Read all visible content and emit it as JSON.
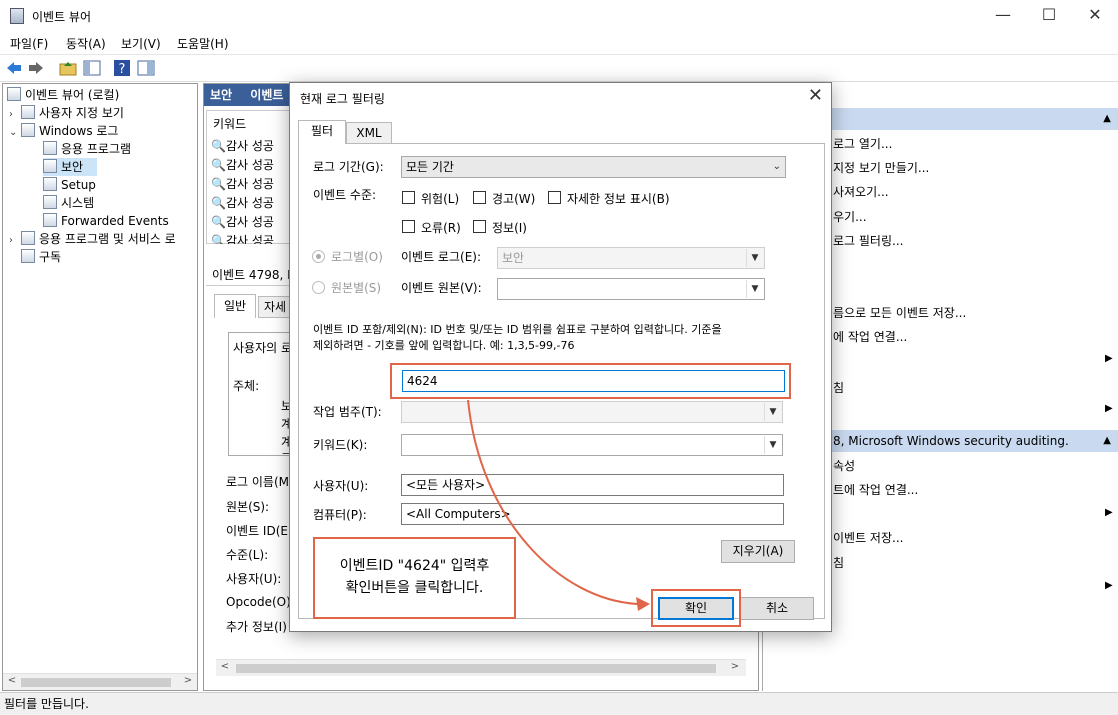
{
  "window": {
    "title": "이벤트 뷰어",
    "minimize": "—",
    "maximize": "☐",
    "close": "✕"
  },
  "menu": [
    "파일(F)",
    "동작(A)",
    "보기(V)",
    "도움말(H)"
  ],
  "tree": {
    "root": "이벤트 뷰어 (로컬)",
    "custom_views": "사용자 지정 보기",
    "windows_logs": "Windows 로그",
    "logs": [
      "응용 프로그램",
      "보안",
      "Setup",
      "시스템",
      "Forwarded Events"
    ],
    "apps_services": "응용 프로그램 및 서비스 로",
    "subscriptions": "구독"
  },
  "middle": {
    "header_left": "보안",
    "header_right": "이벤트",
    "column_keyword": "키워드",
    "rows": [
      "감사 성공",
      "감사 성공",
      "감사 성공",
      "감사 성공",
      "감사 성공",
      "감사 성공"
    ],
    "event_title": "이벤트 4798, M",
    "tab_general": "일반",
    "tab_details": "자세",
    "desc_line1": "사용자의 로",
    "desc_subject": "주체:",
    "desc_frags": [
      "보",
      "계",
      "계",
      "그"
    ],
    "fields": [
      "로그 이름(M",
      "원본(S):",
      "이벤트 ID(E",
      "수준(L):",
      "사용자(U):",
      "Opcode(O):",
      "추가 정보(I)"
    ]
  },
  "right": {
    "actions_top": [
      "로그 열기...",
      "지정 보기 만들기...",
      "사져오기...",
      "우기...",
      "로그 필터링..."
    ],
    "actions_mid": [
      "름으로 모든 이벤트 저장...",
      "에 작업 연결..."
    ],
    "actions_mid2": [
      "침"
    ],
    "section2": "8, Microsoft Windows security auditing.",
    "actions_bot": [
      "속성",
      "트에 작업 연결...",
      "이벤트 저장...",
      "침"
    ]
  },
  "status": "필터를 만듭니다.",
  "dialog": {
    "title": "현재 로그 필터링",
    "tabs": [
      "필터",
      "XML"
    ],
    "log_period_label": "로그 기간(G):",
    "log_period_value": "모든 기간",
    "event_level_label": "이벤트 수준:",
    "levels": [
      "위험(L)",
      "경고(W)",
      "자세한 정보 표시(B)",
      "오류(R)",
      "정보(I)"
    ],
    "by_log": "로그별(O)",
    "by_source": "원본별(S)",
    "event_log_label": "이벤트 로그(E):",
    "event_log_value": "보안",
    "event_source_label": "이벤트 원본(V):",
    "event_id_help1": "이벤트 ID 포함/제외(N): ID 번호 및/또는 ID 범위를 쉼표로 구분하여 입력합니다. 기준을",
    "event_id_help2": "제외하려면 - 기호를 앞에 입력합니다. 예: 1,3,5-99,-76",
    "event_id_value": "4624",
    "task_category_label": "작업 범주(T):",
    "keyword_label": "키워드(K):",
    "user_label": "사용자(U):",
    "user_value": "<모든 사용자>",
    "computer_label": "컴퓨터(P):",
    "computer_value": "<All Computers>",
    "clear_button": "지우기(A)",
    "ok_button": "확인",
    "cancel_button": "취소"
  },
  "callout": {
    "line1": "이벤트ID \"4624\" 입력후",
    "line2": "확인버튼을 클릭합니다."
  },
  "colors": {
    "accent": "#0078d7",
    "annotation": "#e0664a",
    "header_blue": "#3a5f99"
  }
}
